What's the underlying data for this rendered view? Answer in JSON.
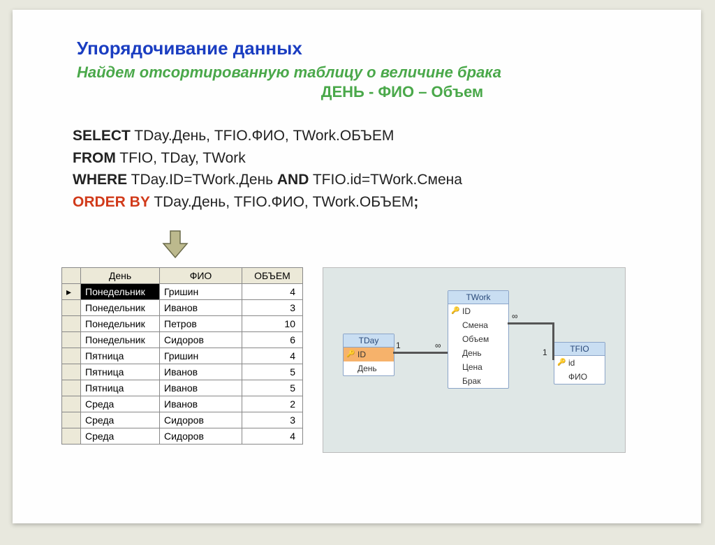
{
  "title": "Упорядочивание данных",
  "subtitle1": "Найдем отсортированную таблицу  о величине брака",
  "subtitle2": "ДЕНЬ - ФИО – Объем",
  "sql": {
    "select_kw": "SELECT",
    "select_cols": " TDay.День, TFIO.ФИО, TWork.ОБЪЕМ",
    "from_kw": "FROM",
    "from_tables": " TFIO, TDay, TWork",
    "where_kw": "WHERE",
    "where_cond1": " TDay.ID=TWork.День ",
    "and_kw": "AND",
    "where_cond2": " TFIO.id=TWork.Смена",
    "orderby_kw": "ORDER BY",
    "orderby_cols": " TDay.День, TFIO.ФИО,  TWork.ОБЪЕМ",
    "semicolon": ";"
  },
  "result": {
    "headers": [
      "День",
      "ФИО",
      "ОБЪЕМ"
    ],
    "rows": [
      {
        "day": "Понедельник",
        "fio": "Гришин",
        "vol": "4",
        "selected": true
      },
      {
        "day": "Понедельник",
        "fio": "Иванов",
        "vol": "3",
        "selected": false
      },
      {
        "day": "Понедельник",
        "fio": "Петров",
        "vol": "10",
        "selected": false
      },
      {
        "day": "Понедельник",
        "fio": "Сидоров",
        "vol": "6",
        "selected": false
      },
      {
        "day": "Пятница",
        "fio": "Гришин",
        "vol": "4",
        "selected": false
      },
      {
        "day": "Пятница",
        "fio": "Иванов",
        "vol": "5",
        "selected": false
      },
      {
        "day": "Пятница",
        "fio": "Иванов",
        "vol": "5",
        "selected": false
      },
      {
        "day": "Среда",
        "fio": "Иванов",
        "vol": "2",
        "selected": false
      },
      {
        "day": "Среда",
        "fio": "Сидоров",
        "vol": "3",
        "selected": false
      },
      {
        "day": "Среда",
        "fio": "Сидоров",
        "vol": "4",
        "selected": false
      }
    ]
  },
  "diagram": {
    "tday": {
      "title": "TDay",
      "pk": "ID",
      "fields": [
        "День"
      ]
    },
    "twork": {
      "title": "TWork",
      "pk": "ID",
      "fields": [
        "Смена",
        "Объем",
        "День",
        "Цена",
        "Брак"
      ]
    },
    "tfio": {
      "title": "TFIO",
      "pk": "id",
      "fields": [
        "ФИО"
      ]
    },
    "rel": {
      "one": "1",
      "many": "∞"
    }
  }
}
